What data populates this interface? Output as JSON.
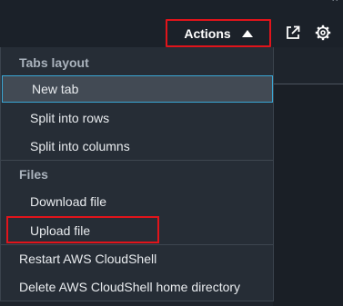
{
  "toolbar": {
    "actions_label": "Actions",
    "icons": [
      "open-in-new-tab-icon",
      "settings-gear-icon"
    ]
  },
  "menu": {
    "tabs_layout": {
      "header": "Tabs layout",
      "items": [
        "New tab",
        "Split into rows",
        "Split into columns"
      ]
    },
    "files": {
      "header": "Files",
      "items": [
        "Download file",
        "Upload file"
      ]
    },
    "other_items": [
      "Restart AWS CloudShell",
      "Delete AWS CloudShell home directory"
    ],
    "highlighted_item": "New tab"
  },
  "colors": {
    "highlight_border": "#3aa7d5",
    "annotation_red": "#e1141b"
  }
}
